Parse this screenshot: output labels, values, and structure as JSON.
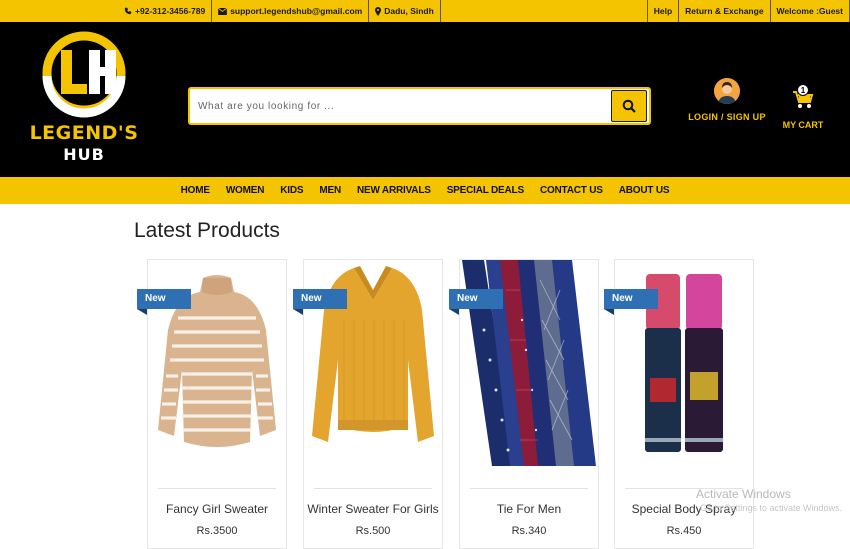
{
  "topbar": {
    "phone": "+92-312-3456-789",
    "email": "support.legendshub@gmail.com",
    "location": "Dadu, Sindh",
    "help": "Help",
    "returns": "Return & Exchange",
    "welcome": "Welcome :Guest"
  },
  "brand": {
    "line1": "LEGEND'S",
    "line2": "HUB",
    "monogram": "LH"
  },
  "search": {
    "placeholder": "What are you looking for ..."
  },
  "account": {
    "login_label": "LOGIN / SIGN UP",
    "cart_label": "MY CART",
    "cart_count": "1"
  },
  "nav": [
    "HOME",
    "WOMEN",
    "KIDS",
    "MEN",
    "NEW ARRIVALS",
    "SPECIAL DEALS",
    "CONTACT US",
    "ABOUT US"
  ],
  "main": {
    "title": "Latest Products",
    "badge_label": "New",
    "products": [
      {
        "name": "Fancy Girl Sweater",
        "price": "Rs.3500",
        "image": "striped-sweater"
      },
      {
        "name": "Winter Sweater For Girls",
        "price": "Rs.500",
        "image": "mustard-sweater"
      },
      {
        "name": "Tie For Men",
        "price": "Rs.340",
        "image": "ties"
      },
      {
        "name": "Special Body Spray",
        "price": "Rs.450",
        "image": "body-spray"
      }
    ]
  },
  "overlay": {
    "watermark": "Activate Windows",
    "watermark_sub": "Go to Settings to activate Windows."
  },
  "colors": {
    "accent": "#f5c400",
    "header_bg": "#000000",
    "ribbon": "#2f6fb4"
  }
}
